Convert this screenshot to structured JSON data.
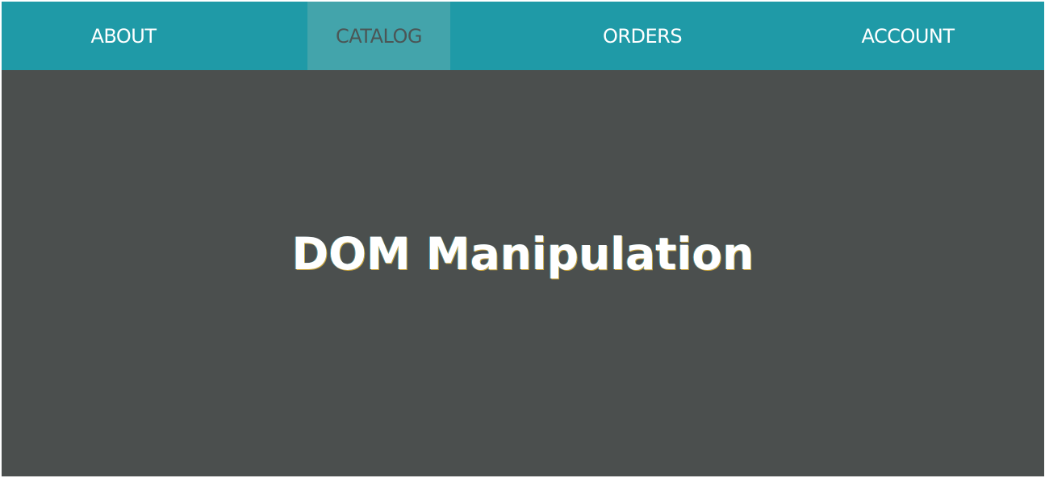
{
  "nav": {
    "items": [
      {
        "label": "ABOUT",
        "active": false
      },
      {
        "label": "CATALOG",
        "active": true
      },
      {
        "label": "ORDERS",
        "active": false
      },
      {
        "label": "ACCOUNT",
        "active": false
      }
    ]
  },
  "hero": {
    "title": "DOM Manipulation"
  },
  "colors": {
    "navbar_bg": "#1f9aa7",
    "nav_active_bg": "#43a4ab",
    "nav_active_text": "#4b5656",
    "page_bg": "#4b4f4e",
    "text": "#ffffff"
  }
}
